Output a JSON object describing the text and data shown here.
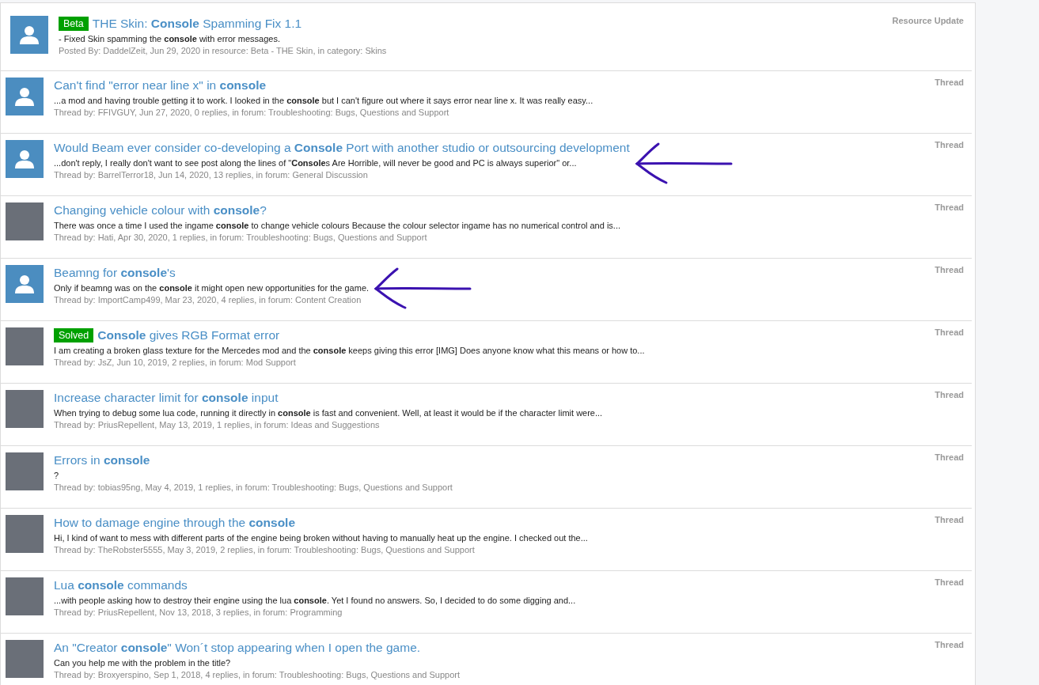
{
  "results": [
    {
      "kind": "default",
      "prefix": {
        "text": "Beta",
        "color": "#00a000"
      },
      "title": "THE Skin: **Console** Spamming Fix 1.1",
      "snippet": "- Fixed Skin spamming the **console** with error messages.",
      "meta": "Posted By: DaddelZeit, Jun 29, 2020 in resource: Beta - THE Skin, in category: Skins",
      "type": "Resource Update",
      "marked": false
    },
    {
      "kind": "default",
      "title": "Can't find \"error near line x\" in **console**",
      "snippet": "...a mod and having trouble getting it to work. I looked in the **console** but I can't figure out where it says error near line x. It was really easy...",
      "meta": "Thread by: FFIVGUY, Jun 27, 2020, 0 replies, in forum: Troubleshooting: Bugs, Questions and Support",
      "type": "Thread",
      "marked": false
    },
    {
      "kind": "default",
      "title": "Would Beam ever consider co-developing a **Console** Port with another studio or outsourcing development",
      "snippet": "...don't reply, I really don't want to see post along the lines of \"**Console**s Are Horrible, will never be good and PC is always superior\" or...",
      "meta": "Thread by: BarrelTerror18, Jun 14, 2020, 13 replies, in forum: General Discussion",
      "type": "Thread",
      "marked": true
    },
    {
      "kind": "picture",
      "title": "Changing vehicle colour with **console**?",
      "snippet": "There was once a time I used the ingame **console** to change vehicle colours Because the colour selector ingame has no numerical control and is...",
      "meta": "Thread by: Hati, Apr 30, 2020, 1 replies, in forum: Troubleshooting: Bugs, Questions and Support",
      "type": "Thread",
      "marked": false
    },
    {
      "kind": "default",
      "title": "Beamng for **console**'s",
      "snippet": "Only if beamng was on the **console** it might open new opportunities for the game.",
      "meta": "Thread by: ImportCamp499, Mar 23, 2020, 4 replies, in forum: Content Creation",
      "type": "Thread",
      "marked": true
    },
    {
      "kind": "picture",
      "prefix": {
        "text": "Solved",
        "color": "#00a000"
      },
      "title": "**Console** gives RGB Format error",
      "snippet": "I am creating a broken glass texture for the Mercedes mod and the **console** keeps giving this error [IMG] Does anyone know what this means or how to...",
      "meta": "Thread by: JsZ, Jun 10, 2019, 2 replies, in forum: Mod Support",
      "type": "Thread",
      "marked": false
    },
    {
      "kind": "picture",
      "title": "Increase character limit for **console** input",
      "snippet": "When trying to debug some lua code, running it directly in **console** is fast and convenient. Well, at least it would be if the character limit were...",
      "meta": "Thread by: PriusRepellent, May 13, 2019, 1 replies, in forum: Ideas and Suggestions",
      "type": "Thread",
      "marked": false
    },
    {
      "kind": "picture",
      "title": "Errors in **console**",
      "snippet": "?",
      "meta": "Thread by: tobias95ng, May 4, 2019, 1 replies, in forum: Troubleshooting: Bugs, Questions and Support",
      "type": "Thread",
      "marked": false
    },
    {
      "kind": "picture",
      "title": "How to damage engine through the **console**",
      "snippet": "Hi, I kind of want to mess with different parts of the engine being broken without having to manually heat up the engine. I checked out the...",
      "meta": "Thread by: TheRobster5555, May 3, 2019, 2 replies, in forum: Troubleshooting: Bugs, Questions and Support",
      "type": "Thread",
      "marked": false
    },
    {
      "kind": "picture",
      "title": "Lua **console** commands",
      "snippet": "...with people asking how to destroy their engine using the lua **console**. Yet I found no answers. So, I decided to do some digging and...",
      "meta": "Thread by: PriusRepellent, Nov 13, 2018, 3 replies, in forum: Programming",
      "type": "Thread",
      "marked": false
    },
    {
      "kind": "picture",
      "title": "An \"Creator **console**\" Won´t stop appearing when I open the game.",
      "snippet": "Can you help me with the problem in the title?",
      "meta": "Thread by: Broxyerspino, Sep 1, 2018, 4 replies, in forum: Troubleshooting: Bugs, Questions and Support",
      "type": "Thread",
      "marked": false
    }
  ]
}
